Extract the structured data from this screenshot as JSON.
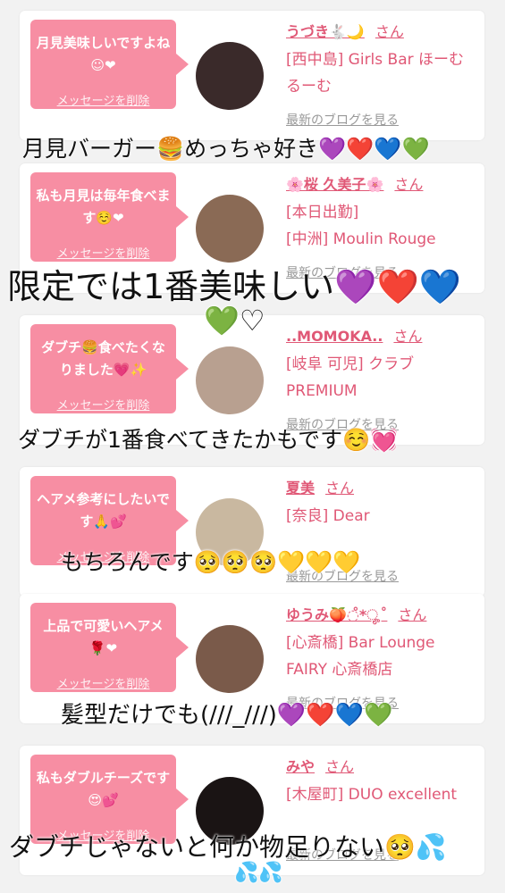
{
  "cards": [
    {
      "message": "月見美味しいですよね☺❤",
      "delete_label": "メッセージを削除",
      "name": "うづき🐇🌙",
      "honorific": "さん",
      "shop": "[西中島] Girls Bar ほーむるーむ",
      "blog_link": "最新のブログを見る",
      "avatar_color": "#3a2a2a"
    },
    {
      "message": "私も月見は毎年食べます☺️❤",
      "delete_label": "メッセージを削除",
      "name": "🌸桜 久美子🌸",
      "honorific": "さん",
      "shop": "[本日出勤]\n[中洲] Moulin Rouge",
      "blog_link": "最新のブログを見る",
      "avatar_color": "#8a6a55"
    },
    {
      "message": "ダブチ🍔食べたくなりました💗✨",
      "delete_label": "メッセージを削除",
      "name": "..MOMOKA..",
      "honorific": "さん",
      "shop": "[岐阜 可児] クラブ PREMIUM",
      "blog_link": "最新のブログを見る",
      "avatar_color": "#b8a090"
    },
    {
      "message": "ヘアメ参考にしたいです🙏💕",
      "delete_label": "メッセージを削除",
      "name": "夏美",
      "honorific": "さん",
      "shop": "[奈良] Dear",
      "blog_link": "最新のブログを見る",
      "avatar_color": "#c9b8a0"
    },
    {
      "message": "上品で可愛いヘアメ🌹❤",
      "delete_label": "メッセージを削除",
      "name": "ゆうみ🍑◌̊*ೄ˚",
      "honorific": "さん",
      "shop": "[心斎橋] Bar Lounge FAIRY 心斎橋店",
      "blog_link": "最新のブログを見る",
      "avatar_color": "#7a5a4a"
    },
    {
      "message": "私もダブルチーズです😍💕",
      "delete_label": "メッセージを削除",
      "name": "みや",
      "honorific": "さん",
      "shop": "[木屋町] DUO excellent",
      "blog_link": "最新のブログを見る",
      "avatar_color": "#1a1414"
    }
  ],
  "overlays": {
    "line1": "月見バーガー🍔めっちゃ好き💜❤️💙💚",
    "line2a": "限定では1番美味しい💜❤️💙",
    "line2b": "💚♡",
    "line3": "ダブチが1番食べてきたかもです☺️💓",
    "line4": "もちろんです🥺🥺🥺💛💛💛",
    "line5": "髪型だけでも(///_///)💜❤️💙💚",
    "line6a": "ダブチじゃないと何か物足りない🥺💦",
    "line6b": "💦💦"
  }
}
